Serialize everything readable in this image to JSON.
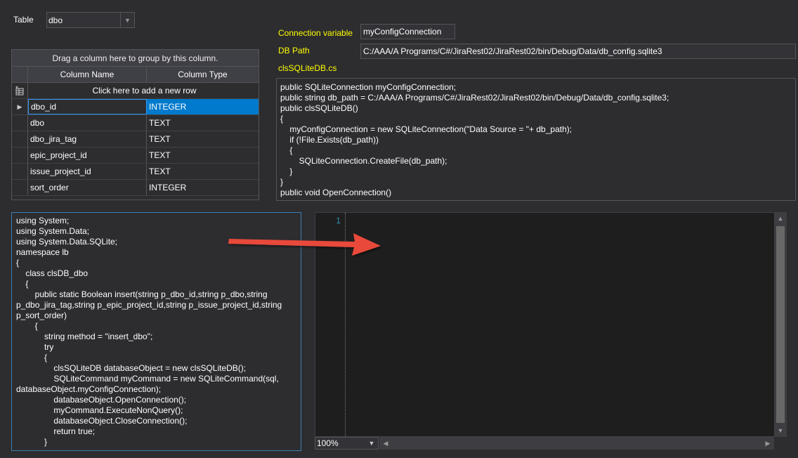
{
  "table_selector": {
    "label": "Table",
    "value": "dbo"
  },
  "grid": {
    "group_hint": "Drag a column here to group by this column.",
    "headers": {
      "name": "Column Name",
      "type": "Column Type"
    },
    "new_row": "Click here to add a new row",
    "rows": [
      {
        "name": "dbo_id",
        "type": "INTEGER"
      },
      {
        "name": "dbo",
        "type": "TEXT"
      },
      {
        "name": "dbo_jira_tag",
        "type": "TEXT"
      },
      {
        "name": "epic_project_id",
        "type": "TEXT"
      },
      {
        "name": "issue_project_id",
        "type": "TEXT"
      },
      {
        "name": "sort_order",
        "type": "INTEGER"
      }
    ]
  },
  "connection": {
    "label": "Connection variable",
    "value": "myConfigConnection"
  },
  "db_path": {
    "label": "DB Path",
    "value": "C:/AAA/A Programs/C#/JiraRest02/JiraRest02/bin/Debug/Data/db_config.sqlite3"
  },
  "cls_file": {
    "label": "clsSQLiteDB.cs"
  },
  "cls_code": "public SQLiteConnection myConfigConnection;\npublic string db_path = C:/AAA/A Programs/C#/JiraRest02/JiraRest02/bin/Debug/Data/db_config.sqlite3;\npublic clsSQLiteDB()\n{\n    myConfigConnection = new SQLiteConnection(\"Data Source = \"+ db_path);\n    if (!File.Exists(db_path))\n    {\n        SQLiteConnection.CreateFile(db_path);\n    }\n}\npublic void OpenConnection()",
  "main_code": "using System;\nusing System.Data;\nusing System.Data.SQLite;\nnamespace lb\n{\n    class clsDB_dbo\n    {\n        public static Boolean insert(string p_dbo_id,string p_dbo,string p_dbo_jira_tag,string p_epic_project_id,string p_issue_project_id,string p_sort_order)\n        {\n            string method = \"insert_dbo\";\n            try\n            {\n                clsSQLiteDB databaseObject = new clsSQLiteDB();\n                SQLiteCommand myCommand = new SQLiteCommand(sql, databaseObject.myConfigConnection);\n                databaseObject.OpenConnection();\n                myCommand.ExecuteNonQuery();\n                databaseObject.CloseConnection();\n                return true;\n            }",
  "editor": {
    "line_number": "1",
    "zoom": "100%"
  },
  "colors": {
    "label_accent": "#ffff00",
    "selection": "#007acc",
    "arrow": "#e84a3b"
  }
}
